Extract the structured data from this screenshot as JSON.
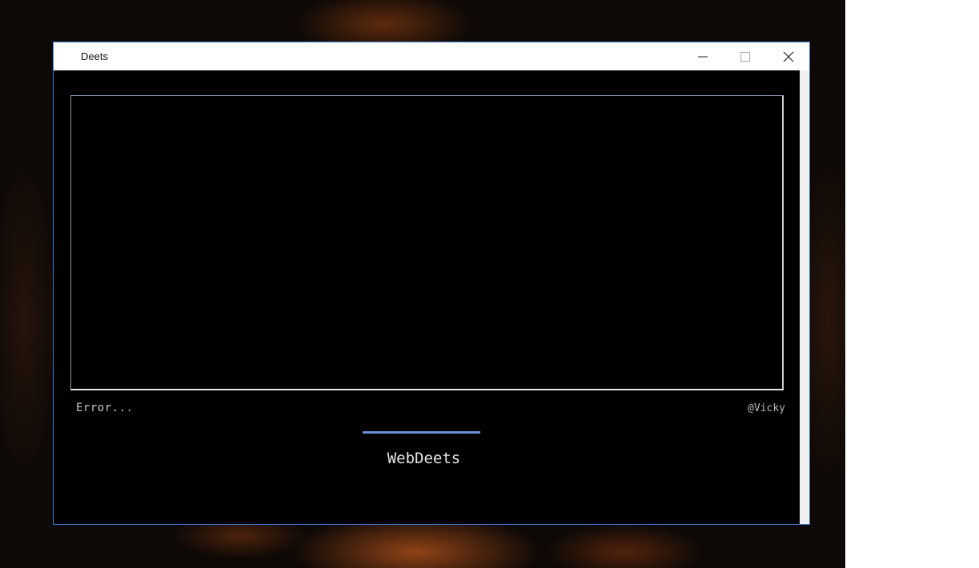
{
  "window": {
    "title": "Deets",
    "controls": {
      "minimize_icon": "minimize-icon",
      "maximize_icon": "maximize-icon",
      "close_icon": "close-icon"
    }
  },
  "main": {
    "output_text": "",
    "status_text": "Error...",
    "author_text": "@Vicky",
    "progress_value": 1.0,
    "brand_text": "WebDeets"
  },
  "colors": {
    "window_border": "#3a7bd5",
    "background": "#000000",
    "progress_accent": "#6a8fd8"
  }
}
